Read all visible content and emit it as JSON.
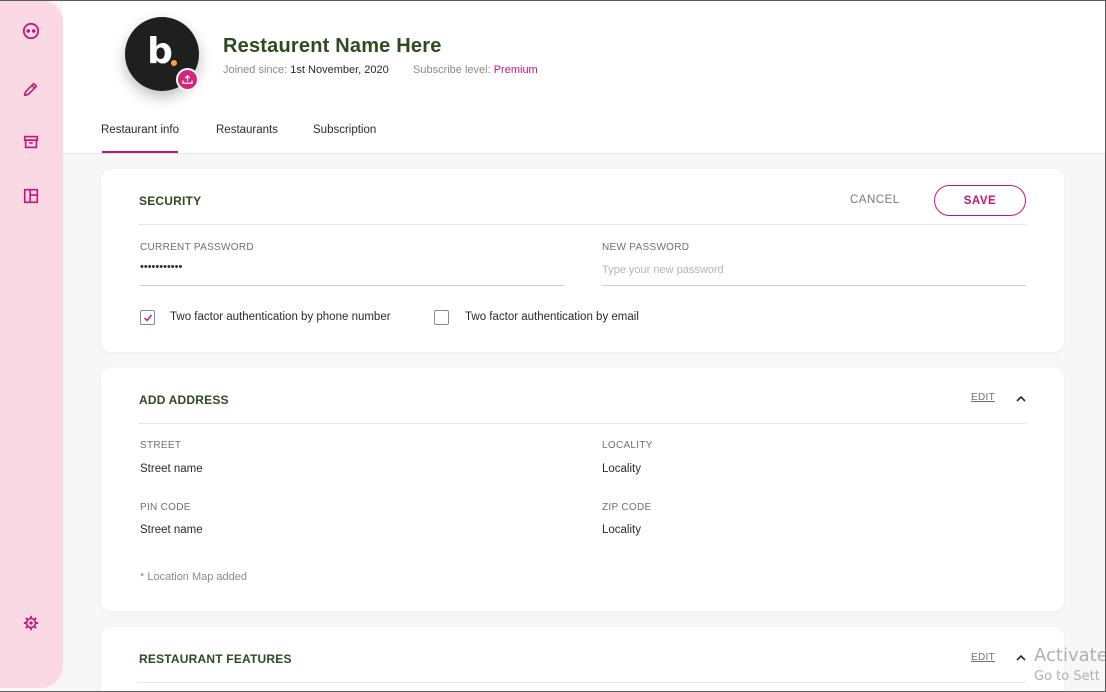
{
  "sidebar": {
    "items": [
      {
        "icon": "mask-icon"
      },
      {
        "icon": "pencil-icon"
      },
      {
        "icon": "archive-icon"
      },
      {
        "icon": "layout-icon"
      }
    ],
    "settings_icon": "gear-icon"
  },
  "profile": {
    "avatar_letter": "b",
    "name": "Restaurent Name Here",
    "joined_label": "Joined since:",
    "joined_value": "1st November, 2020",
    "subscribe_label": "Subscribe level:",
    "subscribe_value": "Premium"
  },
  "tabs": [
    {
      "label": "Restaurant info",
      "active": true
    },
    {
      "label": "Restaurants",
      "active": false
    },
    {
      "label": "Subscription",
      "active": false
    }
  ],
  "security": {
    "title": "SECURITY",
    "cancel_label": "CANCEL",
    "save_label": "SAVE",
    "current_password_label": "CURRENT PASSWORD",
    "current_password_value": "•••••••••••",
    "new_password_label": "NEW PASSWORD",
    "new_password_placeholder": "Type your new password",
    "two_factor_phone_label": "Two factor authentication by phone number",
    "two_factor_phone_checked": true,
    "two_factor_email_label": "Two factor authentication by email",
    "two_factor_email_checked": false
  },
  "address": {
    "title": "ADD ADDRESS",
    "edit_label": "EDIT",
    "street_label": "STREET",
    "street_value": "Street name",
    "locality_label": "LOCALITY",
    "locality_value": "Locality",
    "pin_label": "PIN CODE",
    "pin_value": "Street name",
    "zip_label": "ZIP CODE",
    "zip_value": "Locality",
    "note": "* Location Map added"
  },
  "features": {
    "title": "RESTAURANT FEATURES",
    "edit_label": "EDIT"
  },
  "watermark": {
    "line1": "Activate",
    "line2": "Go to Sett"
  },
  "colors": {
    "accent": "#c2186e",
    "sidebar_bg": "#fbd9e4",
    "title_green": "#2e4a1f"
  }
}
